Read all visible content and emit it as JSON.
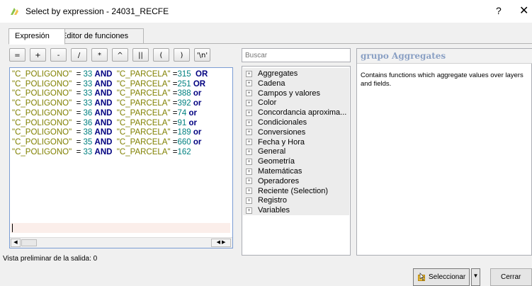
{
  "window": {
    "title": "Select by expression - 24031_RECFE",
    "help_glyph": "?",
    "close_glyph": "✕",
    "icon": "qgis-select-expression-icon"
  },
  "tabs": [
    {
      "label": "Expresión",
      "active": true
    },
    {
      "label": "Editor de funciones",
      "active": false
    }
  ],
  "operators": [
    "=",
    "+",
    "-",
    "/",
    "*",
    "^",
    "||",
    "(",
    ")",
    "'\\n'"
  ],
  "expression_lines": [
    {
      "field1": "\"C_POLIGONO\"",
      "op1": "  = ",
      "num1": "33",
      "kw": "AND",
      "field2": "\"C_PARCELA\"",
      "op2": " =",
      "num2": "315",
      "tail": "OR",
      "gap": "  "
    },
    {
      "field1": "\"C_POLIGONO\"",
      "op1": "  = ",
      "num1": "33",
      "kw": "AND",
      "field2": "\"C_PARCELA\"",
      "op2": " =",
      "num2": "251",
      "tail": "OR",
      "gap": " "
    },
    {
      "field1": "\"C_POLIGONO\"",
      "op1": "  = ",
      "num1": "33",
      "kw": "AND",
      "field2": "\"C_PARCELA\"",
      "op2": " =",
      "num2": "388",
      "tail": "or",
      "gap": " "
    },
    {
      "field1": "\"C_POLIGONO\"",
      "op1": "  = ",
      "num1": "33",
      "kw": "AND",
      "field2": "\"C_PARCELA\"",
      "op2": " =",
      "num2": "392",
      "tail": "or",
      "gap": " "
    },
    {
      "field1": "\"C_POLIGONO\"",
      "op1": "  = ",
      "num1": "36",
      "kw": "AND",
      "field2": "\"C_PARCELA\"",
      "op2": " =",
      "num2": "74",
      "tail": "or",
      "gap": " "
    },
    {
      "field1": "\"C_POLIGONO\"",
      "op1": "  = ",
      "num1": "36",
      "kw": "AND",
      "field2": "\"C_PARCELA\"",
      "op2": " =",
      "num2": "91",
      "tail": "or",
      "gap": " "
    },
    {
      "field1": "\"C_POLIGONO\"",
      "op1": "  = ",
      "num1": "38",
      "kw": "AND",
      "field2": "\"C_PARCELA\"",
      "op2": " =",
      "num2": "189",
      "tail": "or",
      "gap": " "
    },
    {
      "field1": "\"C_POLIGONO\"",
      "op1": "  = ",
      "num1": "35",
      "kw": "AND",
      "field2": "\"C_PARCELA\"",
      "op2": " =",
      "num2": "660",
      "tail": "or",
      "gap": " "
    },
    {
      "field1": "\"C_POLIGONO\"",
      "op1": "  = ",
      "num1": "33",
      "kw": "AND",
      "field2": "\"C_PARCELA\"",
      "op2": " =",
      "num2": "162",
      "tail": "",
      "gap": ""
    }
  ],
  "editor_scroll": {
    "left_arrow": "◀",
    "right_arrow": "◀ ▶"
  },
  "output_preview": "Vista preliminar de la salida:  0",
  "search": {
    "placeholder": "Buscar"
  },
  "function_groups": [
    "Aggregates",
    "Cadena",
    "Campos y valores",
    "Color",
    "Concordancia aproxima...",
    "Condicionales",
    "Conversiones",
    "Fecha y Hora",
    "General",
    "Geometría",
    "Matemáticas",
    "Operadores",
    "Reciente (Selection)",
    "Registro",
    "Variables"
  ],
  "tree_expander": "+",
  "help": {
    "title": "grupo Aggregates",
    "text": "Contains functions which aggregate values over layers and fields."
  },
  "buttons": {
    "select": "Seleccionar",
    "select_dropdown": "▼",
    "close": "Cerrar"
  },
  "colors": {
    "string": "#808000",
    "number": "#008080",
    "keyword": "#000080",
    "help_title": "#8aa0c4"
  }
}
